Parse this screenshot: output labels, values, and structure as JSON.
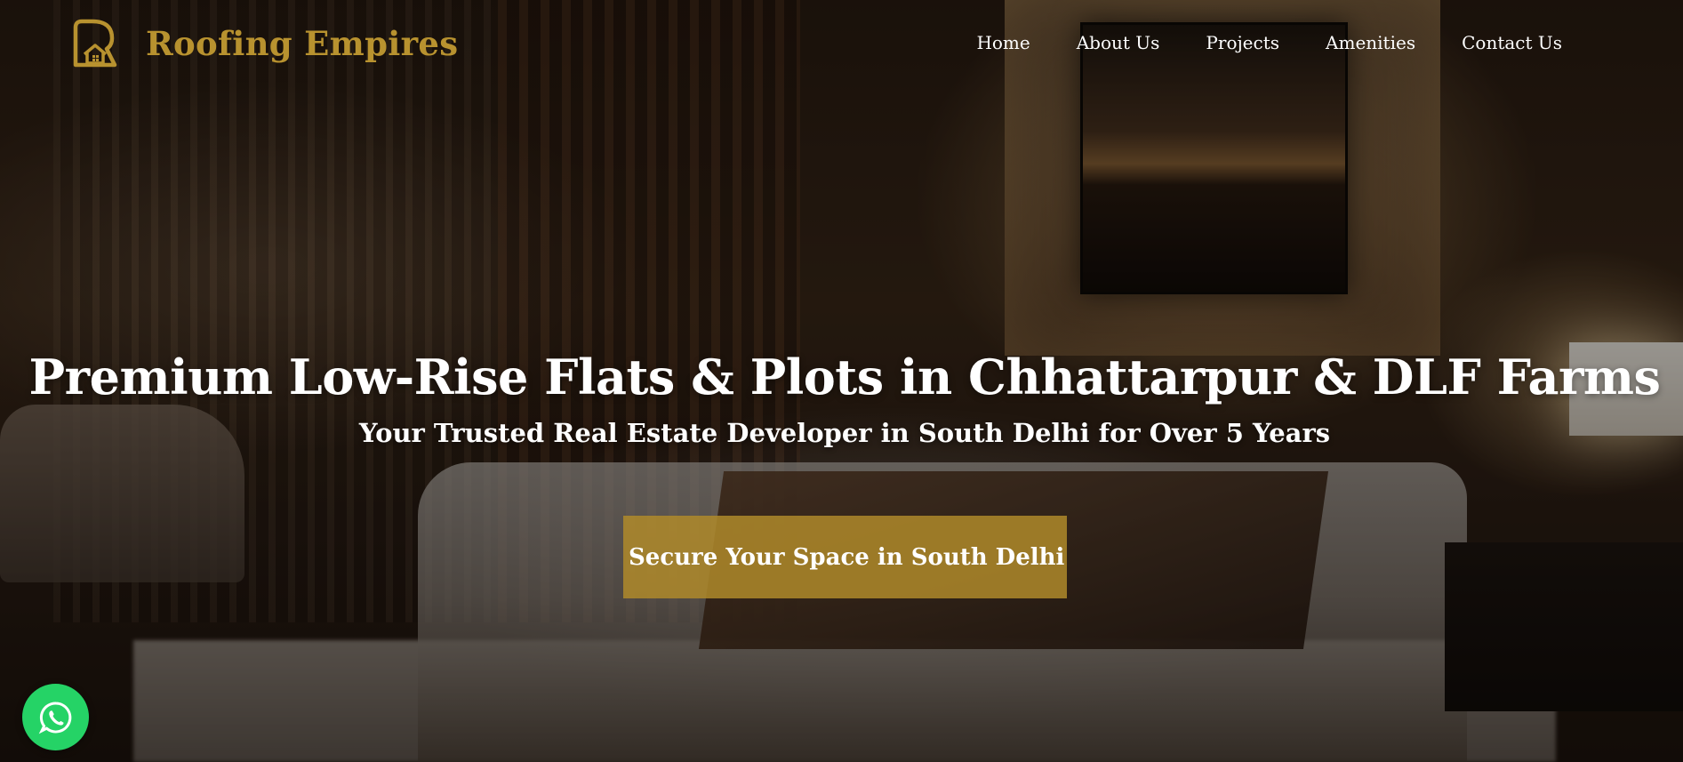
{
  "brand": {
    "name": "Roofing Empires",
    "logo_icon": "house-outline-logo-icon",
    "color": "#b8922f"
  },
  "nav": {
    "items": [
      {
        "label": "Home"
      },
      {
        "label": "About Us"
      },
      {
        "label": "Projects"
      },
      {
        "label": "Amenities"
      },
      {
        "label": "Contact Us"
      }
    ]
  },
  "hero": {
    "title": "Premium Low-Rise Flats & Plots in Chhattarpur & DLF Farms",
    "subtitle": "Your Trusted Real Estate Developer in South Delhi for Over 5 Years",
    "cta_label": "Secure Your Space in South Delhi",
    "cta_color": "#af8a2a"
  },
  "floating": {
    "whatsapp_icon": "whatsapp-icon",
    "whatsapp_color": "#25d366"
  }
}
